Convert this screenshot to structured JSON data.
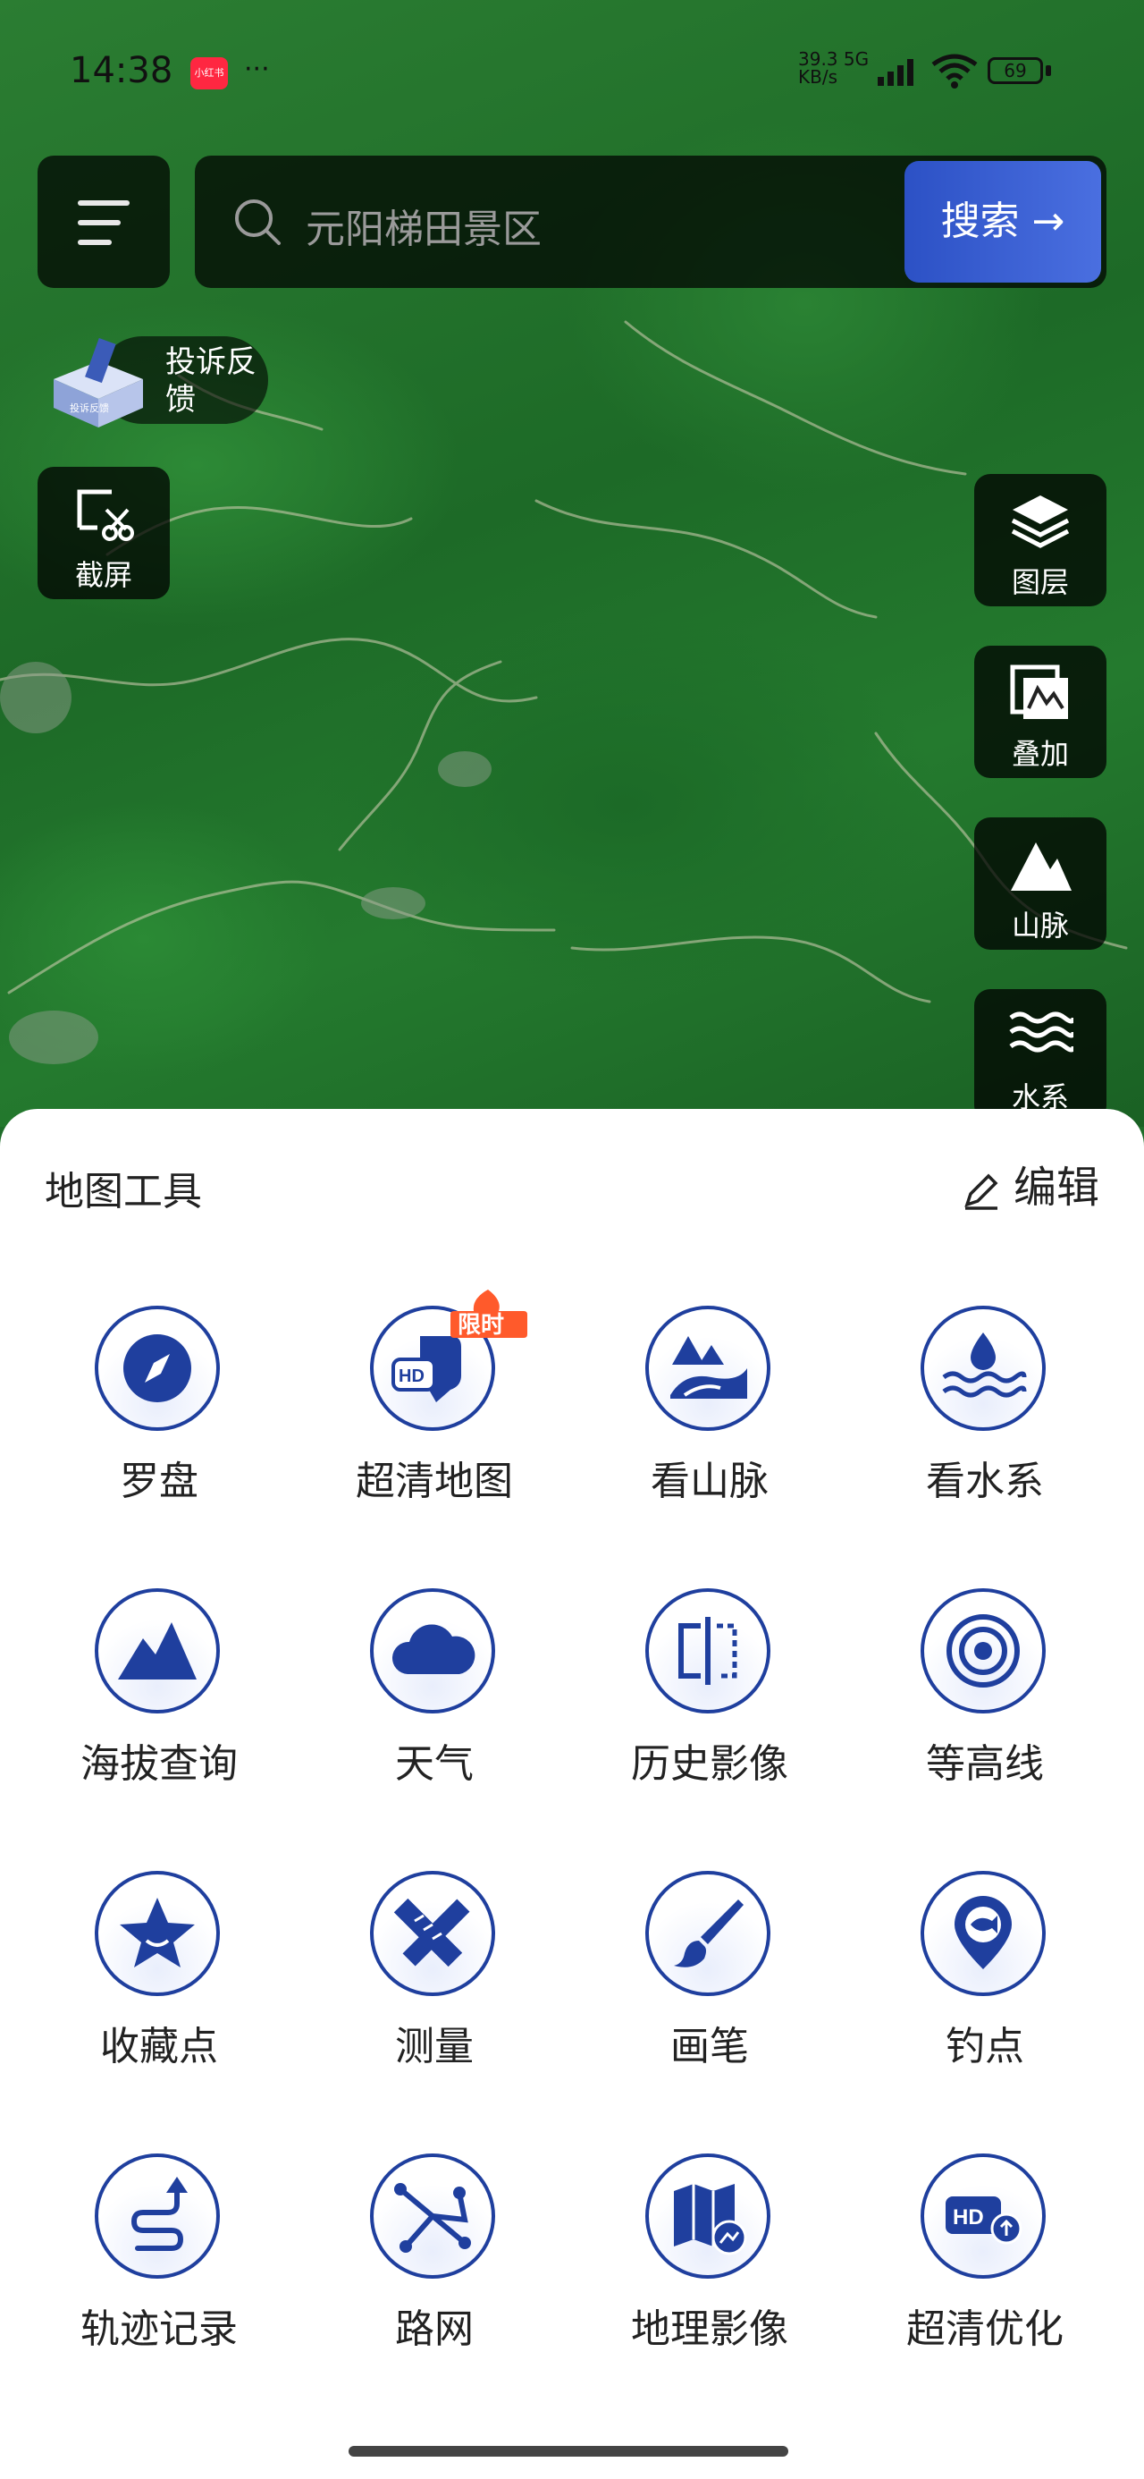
{
  "status": {
    "time": "14:38",
    "app_badge": "小红书",
    "dots": "···",
    "net_speed": "39.3",
    "net_unit": "KB/s",
    "net_type": "5G",
    "battery": "69"
  },
  "search": {
    "placeholder": "元阳梯田景区",
    "button": "搜索 →"
  },
  "feedback": {
    "label": "投诉反馈",
    "cube_text": "投诉反馈"
  },
  "left_tools": {
    "screenshot": "截屏"
  },
  "right_tools": [
    {
      "label": "图层",
      "icon": "layers-icon"
    },
    {
      "label": "叠加",
      "icon": "overlay-icon"
    },
    {
      "label": "山脉",
      "icon": "mountain-icon"
    },
    {
      "label": "水系",
      "icon": "water-icon"
    }
  ],
  "sheet": {
    "title": "地图工具",
    "edit": "编辑",
    "hot_badge": "限时",
    "tools": [
      {
        "label": "罗盘",
        "icon": "compass-icon"
      },
      {
        "label": "超清地图",
        "icon": "hd-map-icon"
      },
      {
        "label": "看山脉",
        "icon": "mountains-icon"
      },
      {
        "label": "看水系",
        "icon": "water-system-icon"
      },
      {
        "label": "海拔查询",
        "icon": "altitude-icon"
      },
      {
        "label": "天气",
        "icon": "cloud-icon"
      },
      {
        "label": "历史影像",
        "icon": "history-image-icon"
      },
      {
        "label": "等高线",
        "icon": "contour-icon"
      },
      {
        "label": "收藏点",
        "icon": "star-icon"
      },
      {
        "label": "测量",
        "icon": "ruler-icon"
      },
      {
        "label": "画笔",
        "icon": "brush-icon"
      },
      {
        "label": "钓点",
        "icon": "fishing-spot-icon"
      },
      {
        "label": "轨迹记录",
        "icon": "track-icon"
      },
      {
        "label": "路网",
        "icon": "road-network-icon"
      },
      {
        "label": "地理影像",
        "icon": "geo-image-icon"
      },
      {
        "label": "超清优化",
        "icon": "hd-optimize-icon"
      }
    ]
  },
  "colors": {
    "accent": "#1f3f9e",
    "search_button": "#3a5fd6",
    "map_green": "#247a2e"
  }
}
